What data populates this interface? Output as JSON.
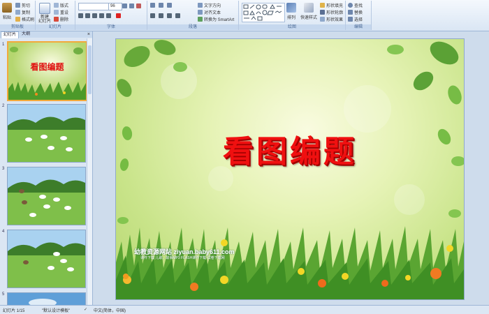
{
  "ribbon": {
    "clipboard": {
      "paste": "粘贴",
      "cut": "剪切",
      "copy": "复制",
      "format_painter": "格式刷",
      "label": "剪贴板"
    },
    "slides": {
      "new_slide": "新建\n幻灯片",
      "layout": "版式",
      "reset": "重设",
      "delete": "删除",
      "label": "幻灯片"
    },
    "font": {
      "size_value": "96",
      "label": "字体"
    },
    "paragraph": {
      "text_direction": "文字方向",
      "align_text": "对齐文本",
      "smartart": "转换为 SmartArt",
      "label": "段落"
    },
    "drawing": {
      "arrange": "排列",
      "quick_styles": "快速样式",
      "shape_fill": "形状填充",
      "shape_outline": "形状轮廓",
      "shape_effects": "形状效果",
      "label": "绘图"
    },
    "editing": {
      "find": "查找",
      "replace": "替换",
      "select": "选择",
      "label": "编辑"
    }
  },
  "left_panel": {
    "tabs": [
      "幻灯片",
      "大纲"
    ],
    "close": "×",
    "thumb_numbers": [
      "1",
      "2",
      "3",
      "4",
      "5"
    ],
    "thumb1_title": "看图编题"
  },
  "slide": {
    "title": "看图编题",
    "site_name": "幼教资源网站  ziyuan.baby611.com",
    "site_sub": "课件下载   儿歌、故事MP3   FLASH课件下载   试卷下载网"
  },
  "status": {
    "slide_count": "幻灯片 1/15",
    "theme": "\"默认设计模板\"",
    "language": "中文(简体，中国)"
  },
  "colors": {
    "title_red": "#f01010",
    "ribbon_bg": "#dae6f4",
    "selected_border": "#f3a93b"
  }
}
